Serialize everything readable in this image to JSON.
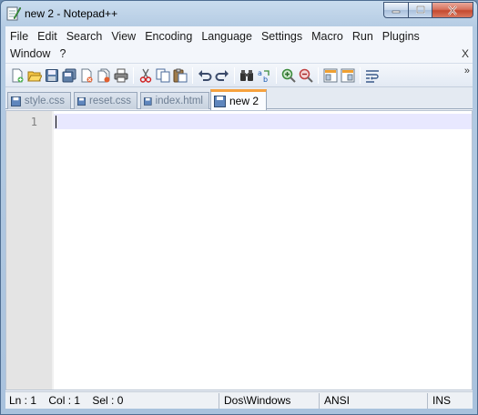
{
  "window": {
    "title": "new  2 - Notepad++",
    "controls": {
      "minimize": "minimize-icon",
      "maximize": "maximize-icon",
      "close": "close-icon"
    }
  },
  "menu": {
    "row1": [
      "File",
      "Edit",
      "Search",
      "View",
      "Encoding",
      "Language",
      "Settings",
      "Macro",
      "Run",
      "Plugins"
    ],
    "row2": [
      "Window",
      "?"
    ],
    "close_doc": "X"
  },
  "toolbar": {
    "buttons": [
      "new-file-icon",
      "open-file-icon",
      "save-icon",
      "save-all-icon",
      "close-icon",
      "close-all-icon",
      "print-icon",
      "cut-icon",
      "copy-icon",
      "paste-icon",
      "undo-icon",
      "redo-icon",
      "find-icon",
      "replace-icon",
      "zoom-in-icon",
      "zoom-out-icon",
      "sync-vertical-icon",
      "sync-horizontal-icon",
      "word-wrap-icon"
    ],
    "more": "»"
  },
  "tabs": [
    {
      "label": "style.css",
      "active": false
    },
    {
      "label": "reset.css",
      "active": false
    },
    {
      "label": "index.html",
      "active": false
    },
    {
      "label": "new  2",
      "active": true
    }
  ],
  "editor": {
    "line_numbers": [
      "1"
    ],
    "content": ""
  },
  "status": {
    "position": "Ln : 1    Col : 1    Sel : 0",
    "eol": "Dos\\Windows",
    "encoding": "ANSI",
    "mode": "INS"
  },
  "colors": {
    "active_tab_accent": "#f7a23e",
    "current_line": "#e8e8ff",
    "gutter": "#e4e4e4"
  }
}
